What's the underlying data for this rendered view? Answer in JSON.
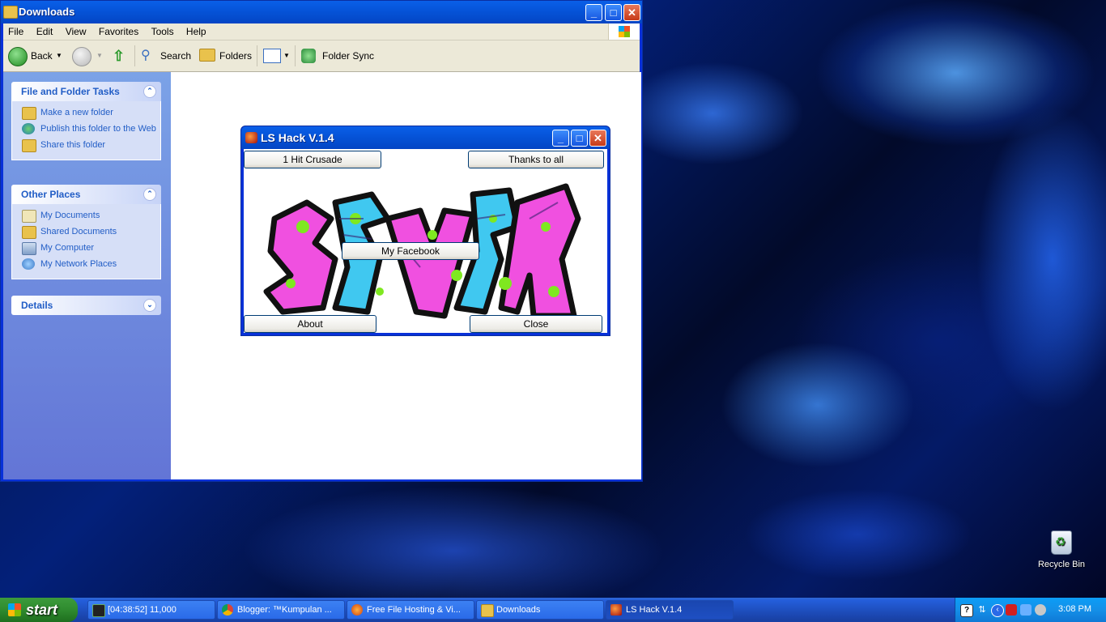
{
  "explorer": {
    "title": "Downloads",
    "menu": [
      "File",
      "Edit",
      "View",
      "Favorites",
      "Tools",
      "Help"
    ],
    "toolbar": {
      "back": "Back",
      "search": "Search",
      "folders": "Folders",
      "folder_sync": "Folder Sync"
    },
    "panels": {
      "tasks": {
        "title": "File and Folder Tasks",
        "items": [
          "Make a new folder",
          "Publish this folder to the Web",
          "Share this folder"
        ]
      },
      "places": {
        "title": "Other Places",
        "items": [
          "My Documents",
          "Shared Documents",
          "My Computer",
          "My Network Places"
        ]
      },
      "details": {
        "title": "Details"
      }
    }
  },
  "dialog": {
    "title": "LS Hack V.1.4",
    "buttons": {
      "hit": "1 Hit Crusade",
      "thanks": "Thanks to all",
      "facebook": "My Facebook",
      "about": "About",
      "close": "Close"
    }
  },
  "desktop": {
    "recycle_bin": "Recycle Bin"
  },
  "taskbar": {
    "start": "start",
    "tasks": [
      "[04:38:52] 11,000",
      "Blogger: ™Kumpulan ...",
      "Free File Hosting & Vi...",
      "Downloads",
      "LS Hack V.1.4"
    ],
    "clock": "3:08 PM"
  },
  "colors": {
    "xp_blue": "#0831d9",
    "task_link": "#215dc6",
    "graffiti_pink": "#f050e0",
    "graffiti_cyan": "#40c8f0",
    "graffiti_green": "#7fe820"
  }
}
